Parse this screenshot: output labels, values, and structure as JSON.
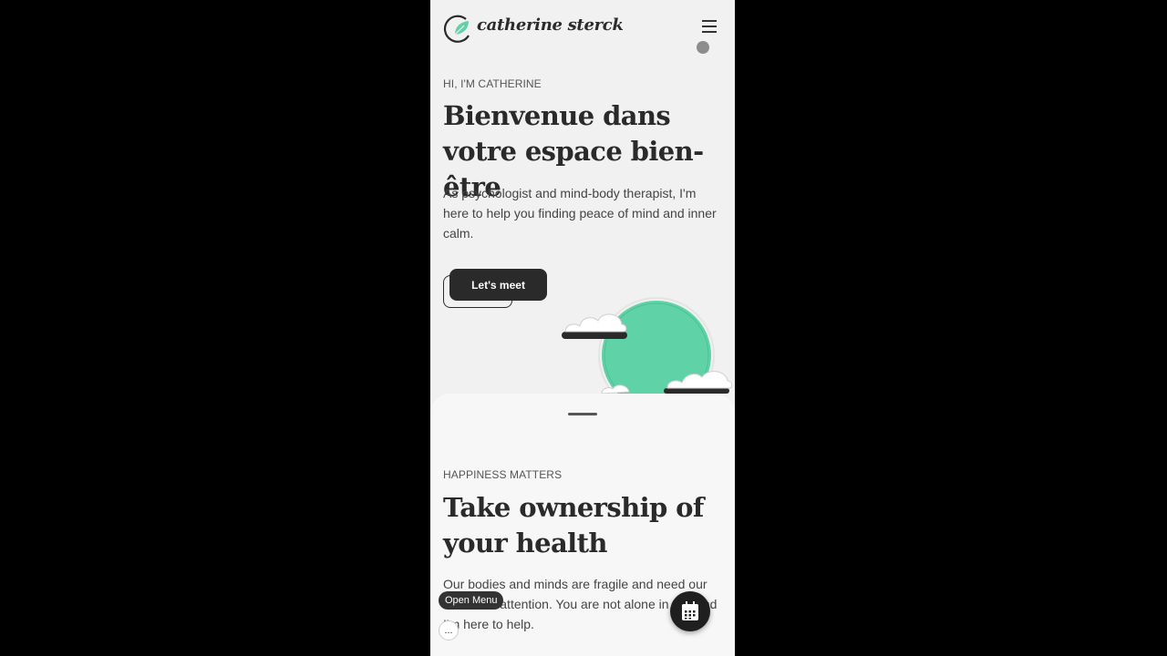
{
  "header": {
    "logo_text": "catherine sterck",
    "menu_icon": "hamburger-icon",
    "logo_icon": "leaf-logo-icon"
  },
  "hero": {
    "eyebrow": "HI, I'M CATHERINE",
    "title": "Bienvenue dans votre espace bien-être",
    "text": "As psychologist and mind-body therapist, I'm here to help you finding peace of mind and inner calm.",
    "cta_label": "Let's meet",
    "illustration": "sun-and-clouds"
  },
  "sheet": {
    "eyebrow": "HAPPINESS MATTERS",
    "title": "Take ownership of your health",
    "text": "Our bodies and minds are fragile and need our individual attention. You are not alone in this and I'm here to help."
  },
  "overlay": {
    "open_menu_tooltip": "Open Menu",
    "more_button_label": "...",
    "calendar_icon": "calendar-icon"
  },
  "colors": {
    "background": "#f1f1f1",
    "accent_green": "#5fd3a7",
    "dark": "#2a2a2a"
  }
}
